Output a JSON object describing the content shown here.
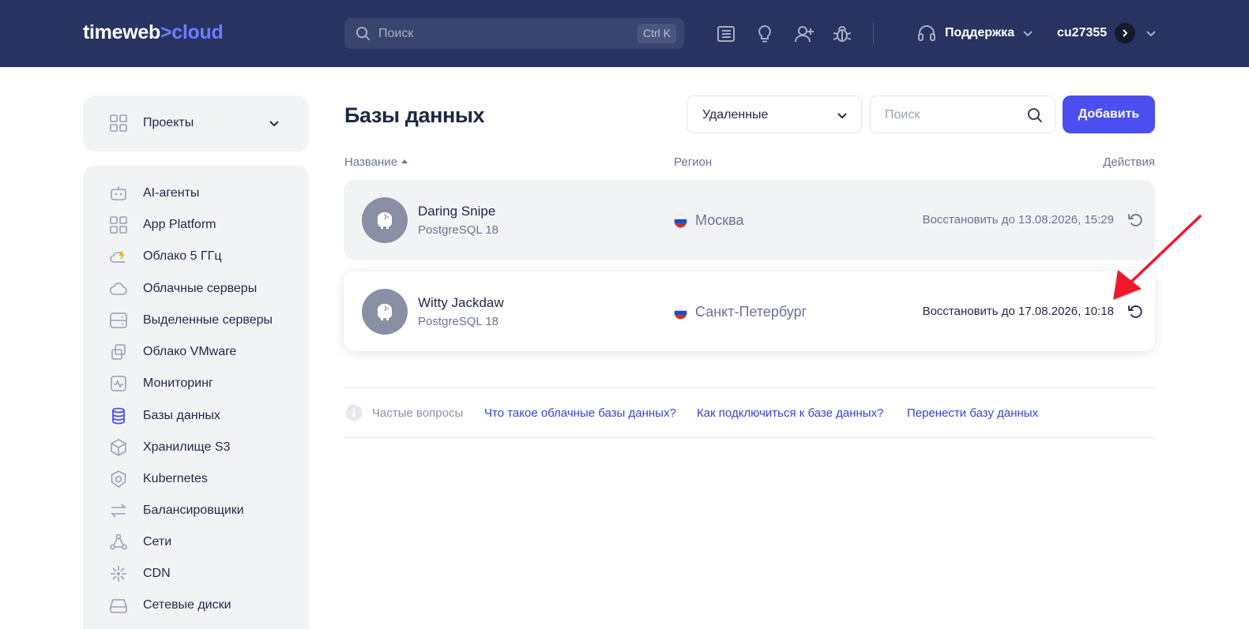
{
  "header": {
    "logo_main": "timeweb",
    "logo_sep": ">",
    "logo_accent": "cloud",
    "search_placeholder": "Поиск",
    "search_shortcut": "Ctrl K",
    "support_label": "Поддержка",
    "username": "cu27355",
    "icons": [
      "docs-icon",
      "lightbulb-icon",
      "add-user-icon",
      "bug-icon",
      "headset-icon"
    ]
  },
  "sidebar": {
    "projects_label": "Проекты",
    "items": [
      {
        "label": "AI-агенты",
        "icon": "robot-icon"
      },
      {
        "label": "App Platform",
        "icon": "grid-icon"
      },
      {
        "label": "Облако 5 ГГц",
        "icon": "cloud-bolt-icon"
      },
      {
        "label": "Облачные серверы",
        "icon": "cloud-icon"
      },
      {
        "label": "Выделенные серверы",
        "icon": "server-icon"
      },
      {
        "label": "Облако VMware",
        "icon": "vmware-icon"
      },
      {
        "label": "Мониторинг",
        "icon": "monitoring-icon"
      },
      {
        "label": "Базы данных",
        "icon": "database-icon",
        "active": true
      },
      {
        "label": "Хранилище S3",
        "icon": "cube-icon"
      },
      {
        "label": "Kubernetes",
        "icon": "kubernetes-icon"
      },
      {
        "label": "Балансировщики",
        "icon": "balancer-icon"
      },
      {
        "label": "Сети",
        "icon": "network-icon"
      },
      {
        "label": "CDN",
        "icon": "cdn-icon"
      },
      {
        "label": "Сетевые диски",
        "icon": "disk-icon"
      }
    ]
  },
  "main": {
    "title": "Базы данных",
    "filter_value": "Удаленные",
    "search_placeholder": "Поиск",
    "add_button": "Добавить",
    "columns": {
      "name": "Название",
      "region": "Регион",
      "actions": "Действия"
    },
    "rows": [
      {
        "name": "Daring Snipe",
        "type": "PostgreSQL 18",
        "region": "Москва",
        "restore": "Восстановить до 13.08.2026, 15:29"
      },
      {
        "name": "Witty Jackdaw",
        "type": "PostgreSQL 18",
        "region": "Санкт-Петербург",
        "restore": "Восстановить до 17.08.2026, 10:18"
      }
    ],
    "faq": {
      "label": "Частые вопросы",
      "links": [
        "Что такое облачные базы данных?",
        "Как подключиться к базе данных?",
        "Перенести базу данных"
      ]
    }
  },
  "colors": {
    "header_bg": "#283361",
    "accent": "#4b4ff0",
    "annotation_arrow": "#f0182a"
  }
}
